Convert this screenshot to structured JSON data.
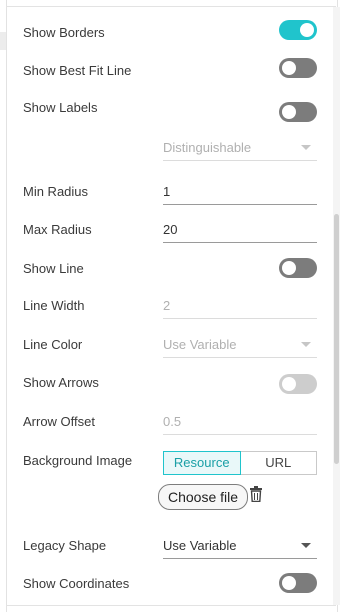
{
  "rows": {
    "show_borders": {
      "label": "Show Borders",
      "on": true
    },
    "show_best_fit_line": {
      "label": "Show Best Fit Line",
      "on": false
    },
    "show_labels": {
      "label": "Show Labels",
      "on": false
    },
    "labels_mode": {
      "value": "Distinguishable"
    },
    "min_radius": {
      "label": "Min Radius",
      "value": "1"
    },
    "max_radius": {
      "label": "Max Radius",
      "value": "20"
    },
    "show_line": {
      "label": "Show Line",
      "on": false
    },
    "line_width": {
      "label": "Line Width",
      "value": "2"
    },
    "line_color": {
      "label": "Line Color",
      "value": "Use Variable"
    },
    "show_arrows": {
      "label": "Show Arrows",
      "on": false
    },
    "arrow_offset": {
      "label": "Arrow Offset",
      "value": "0.5"
    },
    "background_image": {
      "label": "Background Image",
      "options": [
        "Resource",
        "URL"
      ],
      "selected": "Resource",
      "choose_file_label": "Choose file"
    },
    "legacy_shape": {
      "label": "Legacy Shape",
      "value": "Use Variable"
    },
    "show_coordinates": {
      "label": "Show Coordinates",
      "on": false
    }
  },
  "colors": {
    "accent": "#20c4cc",
    "toggle_off": "#7c7c7c",
    "toggle_disabled": "#cdcdcd"
  },
  "icons": {
    "delete": "trash-icon",
    "dropdown": "chevron-down-icon"
  }
}
